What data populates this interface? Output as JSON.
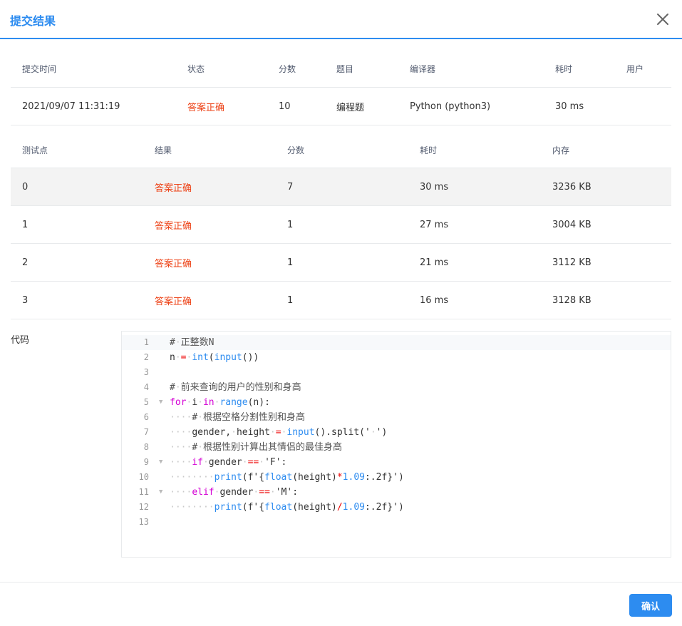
{
  "dialog": {
    "title": "提交结果",
    "confirm_label": "确认"
  },
  "summary": {
    "headers": [
      "提交时间",
      "状态",
      "分数",
      "题目",
      "编译器",
      "耗时",
      "用户"
    ],
    "row": {
      "time": "2021/09/07 11:31:19",
      "status": "答案正确",
      "score": "10",
      "problem": "编程题",
      "compiler": "Python (python3)",
      "elapsed": "30 ms",
      "user": ""
    }
  },
  "tests": {
    "headers": [
      "测试点",
      "结果",
      "分数",
      "耗时",
      "内存"
    ],
    "rows": [
      {
        "id": "0",
        "result": "答案正确",
        "score": "7",
        "time": "30 ms",
        "memory": "3236 KB"
      },
      {
        "id": "1",
        "result": "答案正确",
        "score": "1",
        "time": "27 ms",
        "memory": "3004 KB"
      },
      {
        "id": "2",
        "result": "答案正确",
        "score": "1",
        "time": "21 ms",
        "memory": "3112 KB"
      },
      {
        "id": "3",
        "result": "答案正确",
        "score": "1",
        "time": "16 ms",
        "memory": "3128 KB"
      }
    ]
  },
  "code": {
    "label": "代码",
    "line_numbers": [
      "1",
      "2",
      "3",
      "4",
      "5",
      "6",
      "7",
      "8",
      "9",
      "10",
      "11",
      "12",
      "13"
    ]
  },
  "colors": {
    "accent": "#2d8cf0",
    "correct": "#ed4014",
    "border": "#e8eaec"
  },
  "icons": {
    "close": "close-icon",
    "fold": "fold-arrow-icon"
  }
}
